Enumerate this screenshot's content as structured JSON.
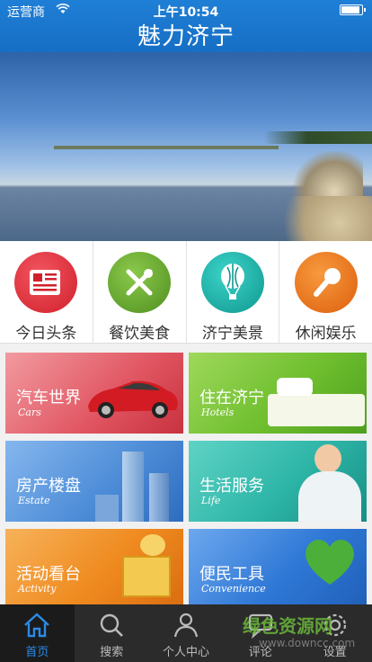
{
  "status": {
    "carrier": "运营商",
    "time": "上午10:54"
  },
  "app_title": "魅力济宁",
  "banner": {
    "slide_count": 5,
    "active_slide": 3
  },
  "categories": [
    {
      "label": "今日头条",
      "icon": "newspaper-icon",
      "color": "#e8333f"
    },
    {
      "label": "餐饮美食",
      "icon": "fork-knife-icon",
      "color": "#6aae2e"
    },
    {
      "label": "济宁美景",
      "icon": "hot-air-balloon-icon",
      "color": "#1cbab0"
    },
    {
      "label": "休闲娱乐",
      "icon": "microphone-icon",
      "color": "#f07a1e"
    }
  ],
  "tiles": [
    {
      "title": "汽车世界",
      "subtitle": "Cars",
      "color": "#e56f7a"
    },
    {
      "title": "住在济宁",
      "subtitle": "Hotels",
      "color": "#7cc63a"
    },
    {
      "title": "房产楼盘",
      "subtitle": "Estate",
      "color": "#4f8ed8"
    },
    {
      "title": "生活服务",
      "subtitle": "Life",
      "color": "#2db5a7"
    },
    {
      "title": "活动看台",
      "subtitle": "Activity",
      "color": "#ef8a1f"
    },
    {
      "title": "便民工具",
      "subtitle": "Convenience",
      "color": "#2f78d6"
    }
  ],
  "tabs": [
    {
      "label": "首页",
      "icon": "home-icon"
    },
    {
      "label": "搜索",
      "icon": "search-icon"
    },
    {
      "label": "个人中心",
      "icon": "user-icon"
    },
    {
      "label": "评论",
      "icon": "comment-icon"
    },
    {
      "label": "设置",
      "icon": "settings-icon"
    }
  ],
  "watermark": {
    "text": "绿色资源网",
    "url": "www.downcc.com"
  }
}
